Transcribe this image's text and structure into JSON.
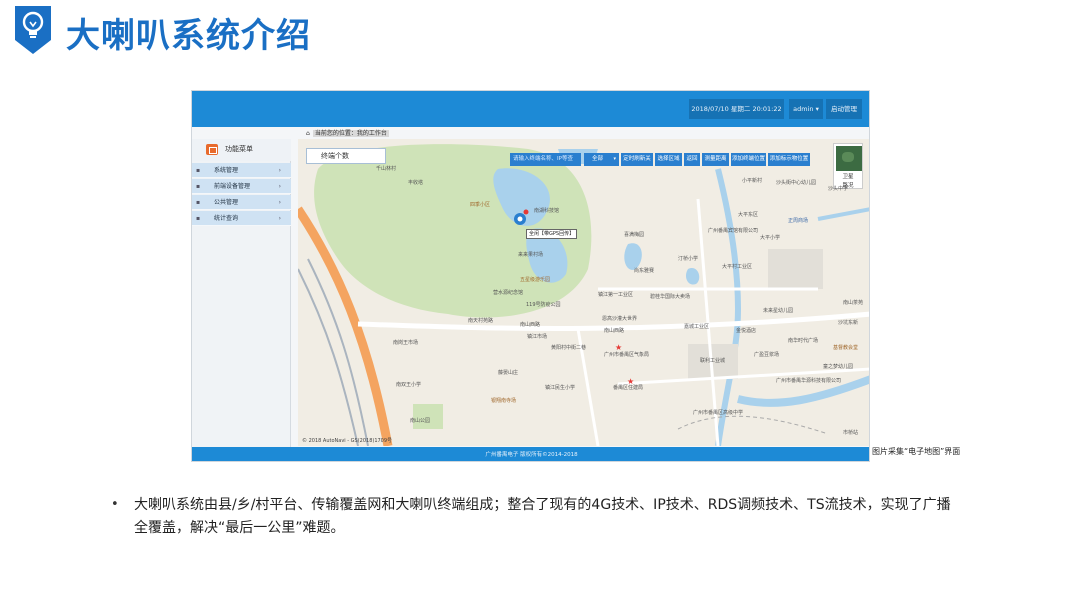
{
  "slide": {
    "title": "大喇叭系统介绍",
    "caption": "图片采集“电子地图”界面",
    "body": "大喇叭系统由县/乡/村平台、传输覆盖网和大喇叭终端组成；整合了现有的4G技术、IP技术、RDS调频技术、TS流技术，实现了广播全覆盖，解决“最后一公里”难题。",
    "bullet": "•",
    "accent_color": "#1a6fc4"
  },
  "app": {
    "topbar": {
      "datetime": "2018/07/10 星期二 20:01:22",
      "user": "admin ▾",
      "start_mgmt": "启动管理"
    },
    "breadcrumb": {
      "text": "当前您的位置：我的工作台",
      "home_icon": "home-icon"
    },
    "sidebar": {
      "header": "功能菜单",
      "items": [
        {
          "label": "系统管理"
        },
        {
          "label": "前端设备管理"
        },
        {
          "label": "公共管理"
        },
        {
          "label": "统计查询"
        }
      ]
    },
    "map": {
      "terminal_count": "终端个数",
      "search_placeholder": "请输入终端名称、IP等查",
      "scope": "全部",
      "toolbar": [
        "定时刷新关",
        "选择区域",
        "返回",
        "测量距离",
        "添加终端位置",
        "添加标示物位置"
      ],
      "satellite_label": "卫星",
      "road_label": "路况",
      "pin_label": "全闲【带GPS回传】",
      "copyright": "© 2018 AutoNavi - GS(2018)1709号",
      "pois": [
        {
          "text": "千山林村"
        },
        {
          "text": "四季小区"
        },
        {
          "text": "南湖科技馆"
        },
        {
          "text": "丰收塔"
        },
        {
          "text": "来来果村场"
        },
        {
          "text": "五星级游乐园"
        },
        {
          "text": "营水源纪念馆"
        },
        {
          "text": "119号防疫公园"
        },
        {
          "text": "南天村苑路"
        },
        {
          "text": "南山西路"
        },
        {
          "text": "南岗王市场"
        },
        {
          "text": "镇江市场"
        },
        {
          "text": "黄阳村中街二巷"
        },
        {
          "text": "南双王小学"
        },
        {
          "text": "藤晏山庄"
        },
        {
          "text": "镇江民生小学"
        },
        {
          "text": "银翔南寺场"
        },
        {
          "text": "南山公园"
        },
        {
          "text": "南山西路"
        },
        {
          "text": "喜满梅园"
        },
        {
          "text": "汀桥小学"
        },
        {
          "text": "尚东雅赛"
        },
        {
          "text": "镇江第一工业区"
        },
        {
          "text": "碧桂华国际大卖场"
        },
        {
          "text": "恩高沙灌大世界"
        },
        {
          "text": "嘉城工业区"
        },
        {
          "text": "广州市番禺区气象局"
        },
        {
          "text": "番禺区住建局"
        },
        {
          "text": "广州市番禺区高级中学"
        },
        {
          "text": "小平新村"
        },
        {
          "text": "沙头街中心幼儿园"
        },
        {
          "text": "沙头中学"
        },
        {
          "text": "大平东区"
        },
        {
          "text": "正周商场"
        },
        {
          "text": "大平小学"
        },
        {
          "text": "广州番禺宾馆有限公司"
        },
        {
          "text": "大平村工业区"
        },
        {
          "text": "金悦酒店"
        },
        {
          "text": "未来星幼儿园"
        },
        {
          "text": "南山茶苑"
        },
        {
          "text": "南华时代广场"
        },
        {
          "text": "沙坑东新"
        },
        {
          "text": "基督教会堂"
        },
        {
          "text": "童之梦幼儿园"
        },
        {
          "text": "广盈豆浆场"
        },
        {
          "text": "联利工业城"
        },
        {
          "text": "广州市番禺华源科技有限公司"
        },
        {
          "text": "市桥站"
        }
      ]
    },
    "footer": "广州番禺电子 版权所有©2014-2018"
  }
}
